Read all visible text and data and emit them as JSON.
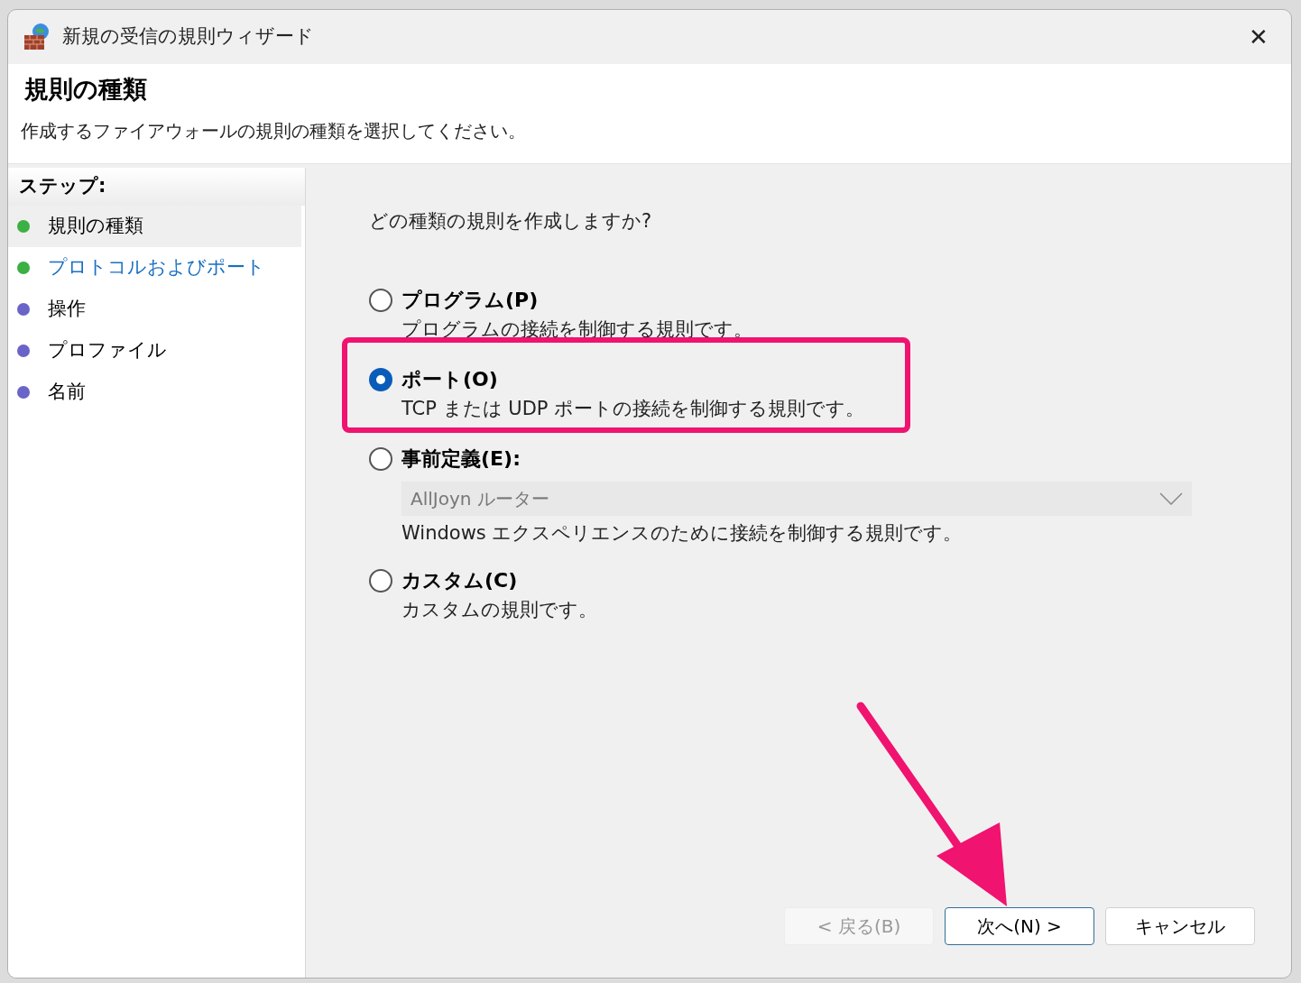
{
  "window": {
    "title": "新規の受信の規則ウィザード",
    "close": "✕"
  },
  "header": {
    "title": "規則の種類",
    "description": "作成するファイアウォールの規則の種類を選択してください。"
  },
  "steps": {
    "heading": "ステップ:",
    "items": [
      {
        "label": "規則の種類",
        "kind": "current",
        "selected": true,
        "color": "#3cb043"
      },
      {
        "label": "プロトコルおよびポート",
        "kind": "link",
        "selected": false,
        "color": "#3cb043"
      },
      {
        "label": "操作",
        "kind": "pending",
        "selected": false,
        "color": "#6a64c8"
      },
      {
        "label": "プロファイル",
        "kind": "pending",
        "selected": false,
        "color": "#6a64c8"
      },
      {
        "label": "名前",
        "kind": "pending",
        "selected": false,
        "color": "#6a64c8"
      }
    ]
  },
  "question": "どの種類の規則を作成しますか?",
  "options": [
    {
      "label": "プログラム(P)",
      "description": "プログラムの接続を制御する規則です。",
      "selected": false,
      "highlighted": false
    },
    {
      "label": "ポート(O)",
      "description": "TCP または UDP ポートの接続を制御する規則です。",
      "selected": true,
      "highlighted": true
    },
    {
      "label": "事前定義(E):",
      "dropdown": {
        "value": "AllJoyn ルーター",
        "disabled": true
      },
      "description": "Windows エクスペリエンスのために接続を制御する規則です。",
      "selected": false,
      "highlighted": false
    },
    {
      "label": "カスタム(C)",
      "description": "カスタムの規則です。",
      "selected": false,
      "highlighted": false
    }
  ],
  "buttons": [
    {
      "label": "< 戻る(B)",
      "disabled": true,
      "focused": false,
      "pointed": false
    },
    {
      "label": "次へ(N) >",
      "disabled": false,
      "focused": true,
      "pointed": true
    },
    {
      "label": "キャンセル",
      "disabled": false,
      "focused": false,
      "pointed": false
    }
  ]
}
